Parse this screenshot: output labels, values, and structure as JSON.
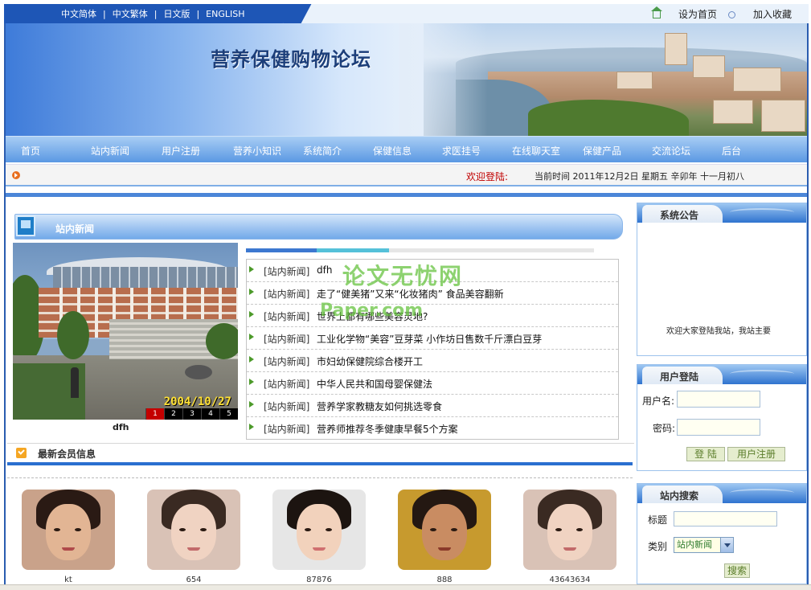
{
  "languages": [
    "中文简体",
    "中文繁体",
    "日文版",
    "ENGLISH"
  ],
  "top_links": {
    "home": "设为首页",
    "favorite": "加入收藏"
  },
  "site": {
    "title": "营养保健购物论坛"
  },
  "nav": [
    "首页",
    "站内新闻",
    "用户注册",
    "营养小知识",
    "系统简介",
    "保健信息",
    "求医挂号",
    "在线聊天室",
    "保健产品",
    "交流论坛",
    "后台"
  ],
  "infobar": {
    "welcome": "欢迎登陆:",
    "datetime": "当前时间   2011年12月2日  星期五  辛卯年  十一月初八"
  },
  "news": {
    "section_title": "站内新闻",
    "photo_date": "2004/10/27",
    "photo_pager": [
      "1",
      "2",
      "3",
      "4",
      "5"
    ],
    "photo_caption": "dfh",
    "items": [
      {
        "category": "[站内新闻]",
        "title": "dfh"
      },
      {
        "category": "[站内新闻]",
        "title": "走了“健美猪”又来“化妆猪肉” 食品美容翻新"
      },
      {
        "category": "[站内新闻]",
        "title": "世界上都有哪些美容灵地?"
      },
      {
        "category": "[站内新闻]",
        "title": "工业化学物“美容”豆芽菜 小作坊日售数千斤漂白豆芽"
      },
      {
        "category": "[站内新闻]",
        "title": "市妇幼保健院综合楼开工"
      },
      {
        "category": "[站内新闻]",
        "title": "中华人民共和国母婴保健法"
      },
      {
        "category": "[站内新闻]",
        "title": "营养学家教糖友如何挑选零食"
      },
      {
        "category": "[站内新闻]",
        "title": "营养师推荐冬季健康早餐5个方案"
      }
    ]
  },
  "watermark": {
    "line1": "论文无忧网",
    "line2": "Paper.com"
  },
  "members": {
    "section_title": "最新会员信息",
    "list": [
      {
        "name": "kt"
      },
      {
        "name": "654"
      },
      {
        "name": "87876"
      },
      {
        "name": "888"
      },
      {
        "name": "43643634"
      }
    ]
  },
  "notice": {
    "title": "系统公告",
    "text": "欢迎大家登陆我站，我站主要"
  },
  "login": {
    "title": "用户登陆",
    "username_label": "用户名:",
    "password_label": "密码:",
    "login_button": "登 陆",
    "register_button": "用户注册"
  },
  "search": {
    "title": "站内搜索",
    "keyword_label": "标题",
    "category_label": "类别",
    "category_value": "站内新闻",
    "button": "搜索"
  }
}
